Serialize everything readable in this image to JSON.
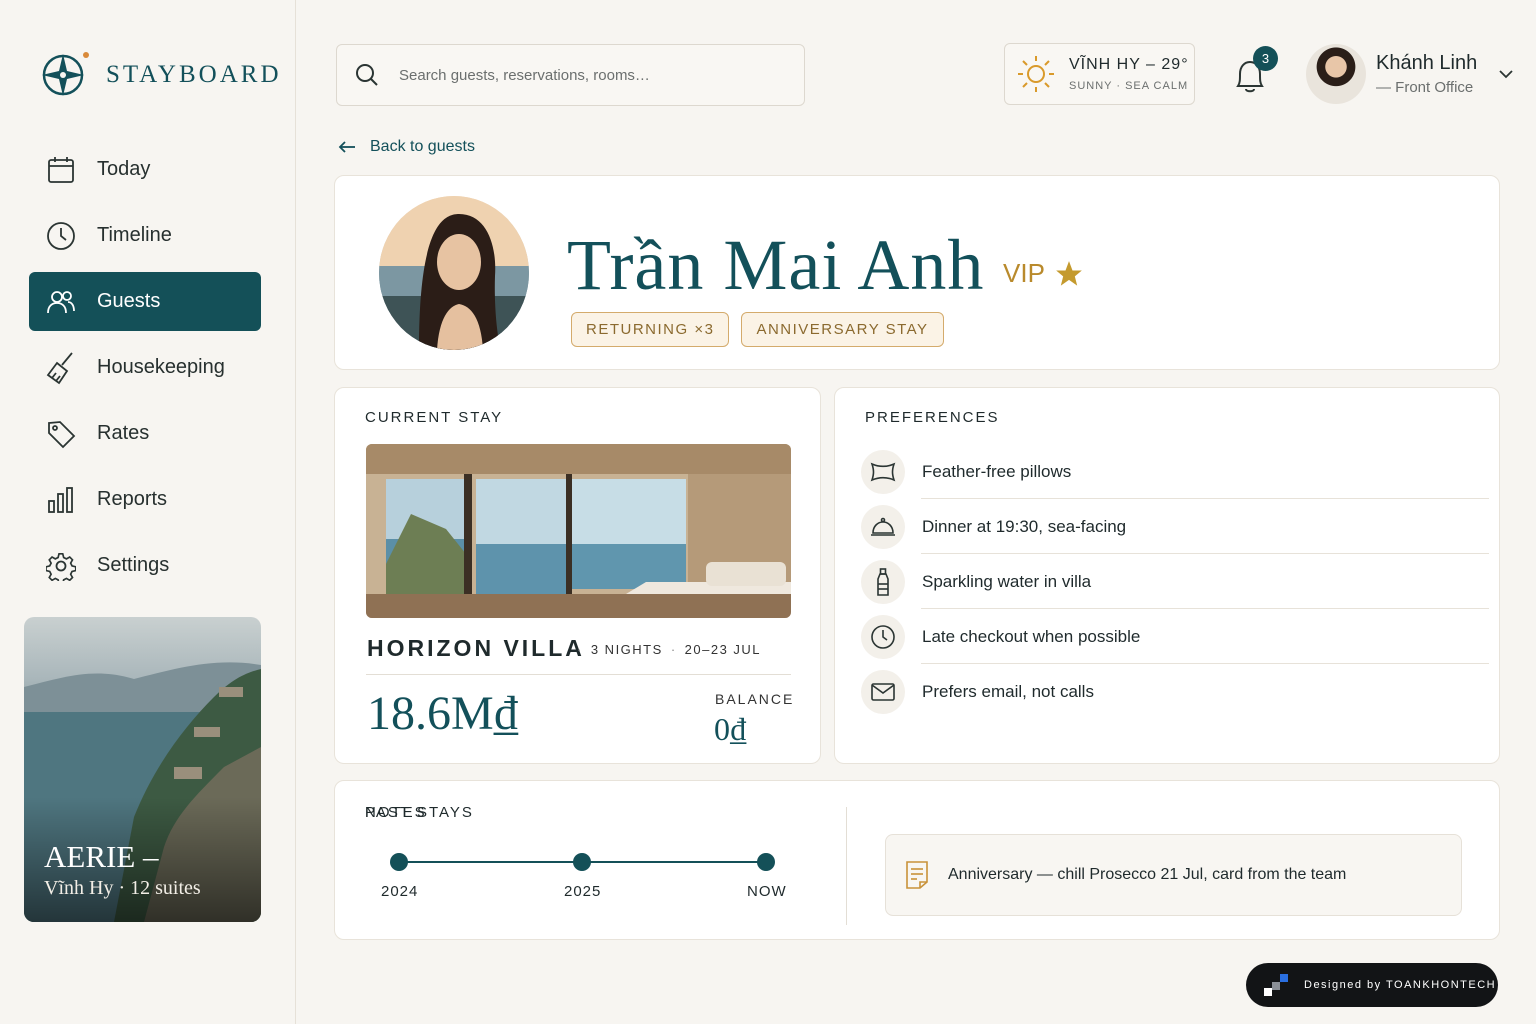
{
  "brand": {
    "name": "STAYBOARD"
  },
  "sidebar": {
    "items": [
      {
        "label": "Today",
        "icon": "calendar-icon",
        "active": false
      },
      {
        "label": "Timeline",
        "icon": "clock-icon",
        "active": false
      },
      {
        "label": "Guests",
        "icon": "users-icon",
        "active": true
      },
      {
        "label": "Housekeeping",
        "icon": "broom-icon",
        "active": false
      },
      {
        "label": "Rates",
        "icon": "tag-icon",
        "active": false
      },
      {
        "label": "Reports",
        "icon": "bar-chart-icon",
        "active": false
      },
      {
        "label": "Settings",
        "icon": "gear-icon",
        "active": false
      }
    ],
    "resort": {
      "name": "AERIE –",
      "sub": "Vĩnh Hy · 12 suites"
    }
  },
  "search": {
    "placeholder": "Search guests, reservations, rooms…"
  },
  "weather": {
    "title": "VĨNH HY – 29°",
    "sub": "SUNNY · SEA CALM",
    "icon": "sun-icon"
  },
  "notifications": {
    "count": "3"
  },
  "user": {
    "name": "Khánh Linh",
    "role": "— Front Office"
  },
  "back": {
    "label": "Back to guests"
  },
  "guest": {
    "name": "Trần Mai Anh",
    "vip": "VIP",
    "tags": [
      "RETURNING ×3",
      "ANNIVERSARY STAY"
    ]
  },
  "current_stay": {
    "title": "CURRENT STAY",
    "room": "HORIZON VILLA",
    "nights": "3 NIGHTS",
    "dates": "20–23 JUL",
    "total": "18.6M₫",
    "balance_label": "BALANCE",
    "balance": "0₫"
  },
  "preferences": {
    "title": "PREFERENCES",
    "items": [
      {
        "label": "Feather-free pillows",
        "icon": "pillow-icon"
      },
      {
        "label": "Dinner at 19:30, sea-facing",
        "icon": "cloche-icon"
      },
      {
        "label": "Sparkling water in villa",
        "icon": "bottle-icon"
      },
      {
        "label": "Late checkout when possible",
        "icon": "clock-icon"
      },
      {
        "label": "Prefers email, not calls",
        "icon": "mail-icon"
      }
    ]
  },
  "past_stays": {
    "title": "PAST STAYS",
    "points": [
      "2024",
      "2025",
      "NOW"
    ]
  },
  "notes": {
    "title": "NOTES",
    "items": [
      {
        "text": "Anniversary — chill Prosecco 21 Jul, card from the team",
        "icon": "note-icon"
      }
    ]
  },
  "credit": {
    "text": "Designed by TOANKHONTECH"
  },
  "colors": {
    "accent": "#145058",
    "gold": "#b98a2c",
    "background": "#f7f5f1"
  }
}
